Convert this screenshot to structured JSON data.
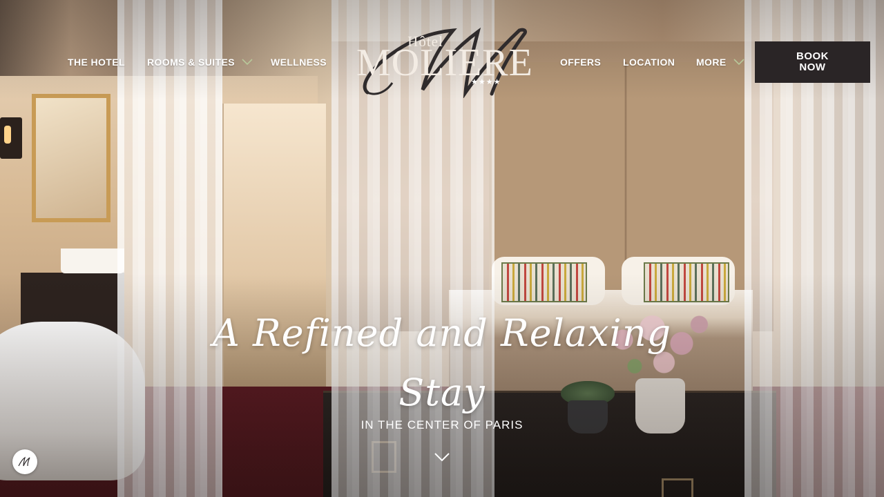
{
  "nav": {
    "left": [
      {
        "label": "THE HOTEL",
        "dropdown": false
      },
      {
        "label": "ROOMS & SUITES",
        "dropdown": true
      },
      {
        "label": "WELLNESS",
        "dropdown": false
      }
    ],
    "right": [
      {
        "label": "OFFERS",
        "dropdown": false
      },
      {
        "label": "LOCATION",
        "dropdown": false
      },
      {
        "label": "MORE",
        "dropdown": true
      }
    ],
    "chevron_color": "#b8c89a"
  },
  "logo": {
    "top_word": "Hôtel",
    "name": "MOLIERE",
    "monogram": "M",
    "stars": "★★★★",
    "color": "#f3ece4",
    "monogram_color": "#2f2b2c"
  },
  "book_button": {
    "label": "BOOK NOW",
    "background": "#2a2526"
  },
  "hero": {
    "title": "A Refined and Relaxing Stay",
    "subtitle": "IN THE CENTER OF PARIS",
    "scroll_icon": "chevron-down-icon"
  },
  "badge": {
    "monogram": "M",
    "icon": "monogram-icon"
  }
}
